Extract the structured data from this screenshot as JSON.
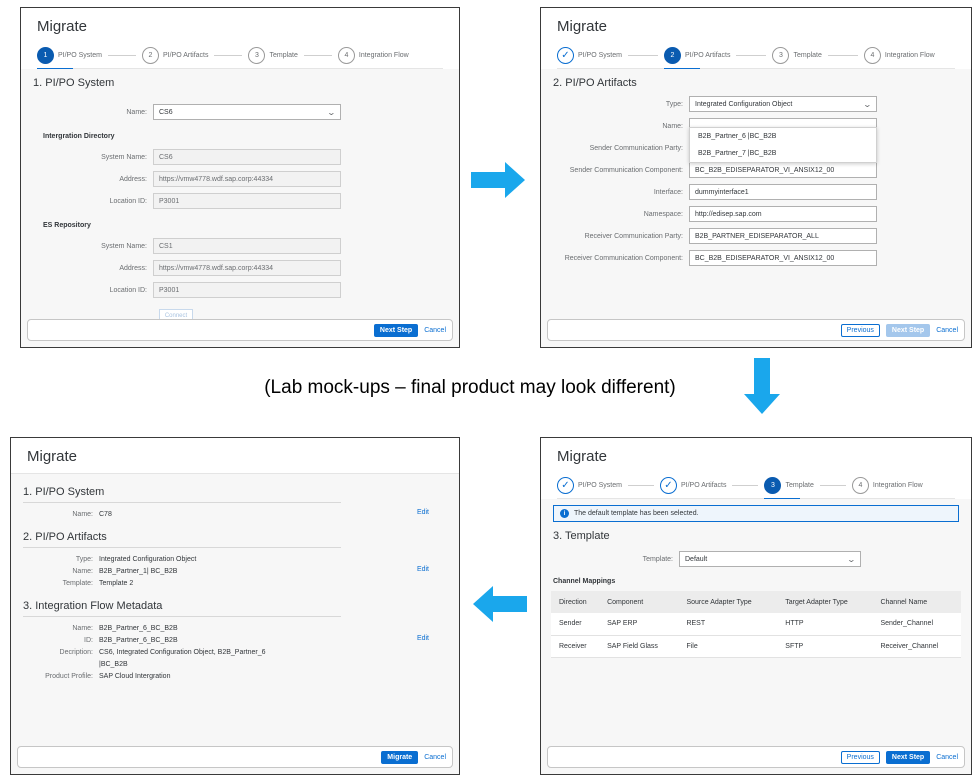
{
  "title": "Migrate",
  "steps": [
    "PI/PO System",
    "PI/PO Artifacts",
    "Template",
    "Integration Flow"
  ],
  "note": "(Lab mock-ups – final product may look different)",
  "p1": {
    "section": "1. PI/PO System",
    "name_label": "Name:",
    "name_value": "CS6",
    "integ_dir": "Intergration Directory",
    "system_name_label": "System Name:",
    "system_name_value": "CS6",
    "address_label": "Address:",
    "address_value": "https://vmw4778.wdf.sap.corp:44334",
    "location_label": "Location ID:",
    "location_value": "P3001",
    "es_repo": "ES Repository",
    "es_system_name_value": "CS1",
    "es_address_value": "https://vmw4778.wdf.sap.corp:44334",
    "es_location_value": "P3001",
    "connect": "Connect",
    "next": "Next Step",
    "cancel": "Cancel"
  },
  "p2": {
    "section": "2. PI/PO Artifacts",
    "fields": [
      {
        "label": "Type:",
        "value": "Integrated Configuration Object"
      },
      {
        "label": "Name:",
        "value": ""
      },
      {
        "label": "Sender Communication Party:",
        "value": ""
      },
      {
        "label": "Sender Communication Component:",
        "value": "BC_B2B_EDISEPARATOR_VI_ANSIX12_00"
      },
      {
        "label": "Interface:",
        "value": "dummyinterface1"
      },
      {
        "label": "Namespace:",
        "value": "http://edisep.sap.com"
      },
      {
        "label": "Receiver Communication Party:",
        "value": "B2B_PARTNER_EDISEPARATOR_ALL"
      },
      {
        "label": "Receiver Communication Component:",
        "value": "BC_B2B_EDISEPARATOR_VI_ANSIX12_00"
      }
    ],
    "dropdown": [
      "B2B_Partner_6 |BC_B2B",
      "B2B_Partner_7 |BC_B2B"
    ],
    "previous": "Previous",
    "next": "Next Step",
    "cancel": "Cancel"
  },
  "p3": {
    "message": "The default template has been selected.",
    "section": "3. Template",
    "template_label": "Template:",
    "template_value": "Default",
    "channel_mappings": "Channel Mappings",
    "columns": [
      "Direction",
      "Component",
      "Source Adapter Type",
      "Target Adapter Type",
      "Channel Name"
    ],
    "rows": [
      [
        "Sender",
        "SAP ERP",
        "REST",
        "HTTP",
        "Sender_Channel"
      ],
      [
        "Receiver",
        "SAP Field Glass",
        "File",
        "SFTP",
        "Receiver_Channel"
      ]
    ],
    "previous": "Previous",
    "next": "Next Step",
    "cancel": "Cancel"
  },
  "p4": {
    "s1": "1. PI/PO System",
    "s1_rows": [
      [
        "Name:",
        "C78"
      ]
    ],
    "s2": "2. PI/PO Artifacts",
    "s2_rows": [
      [
        "Type:",
        "Integrated Configuration Object"
      ],
      [
        "Name:",
        "B2B_Partner_1| BC_B2B"
      ],
      [
        "Template:",
        "Template 2"
      ]
    ],
    "s3": "3. Integration Flow Metadata",
    "s3_rows": [
      [
        "Name:",
        "B2B_Partner_6_BC_B2B"
      ],
      [
        "ID:",
        "B2B_Partner_6_BC_B2B"
      ],
      [
        "Decription:",
        "CS6, Integrated Configuration Object, B2B_Partner_6"
      ],
      [
        "",
        "|BC_B2B"
      ],
      [
        "Product Profile:",
        "SAP Cloud Intergration"
      ]
    ],
    "edit": "Edit",
    "migrate": "Migrate",
    "cancel": "Cancel"
  },
  "colors": {
    "accent": "#0a6ed1",
    "arrow": "#1aa7ec"
  }
}
